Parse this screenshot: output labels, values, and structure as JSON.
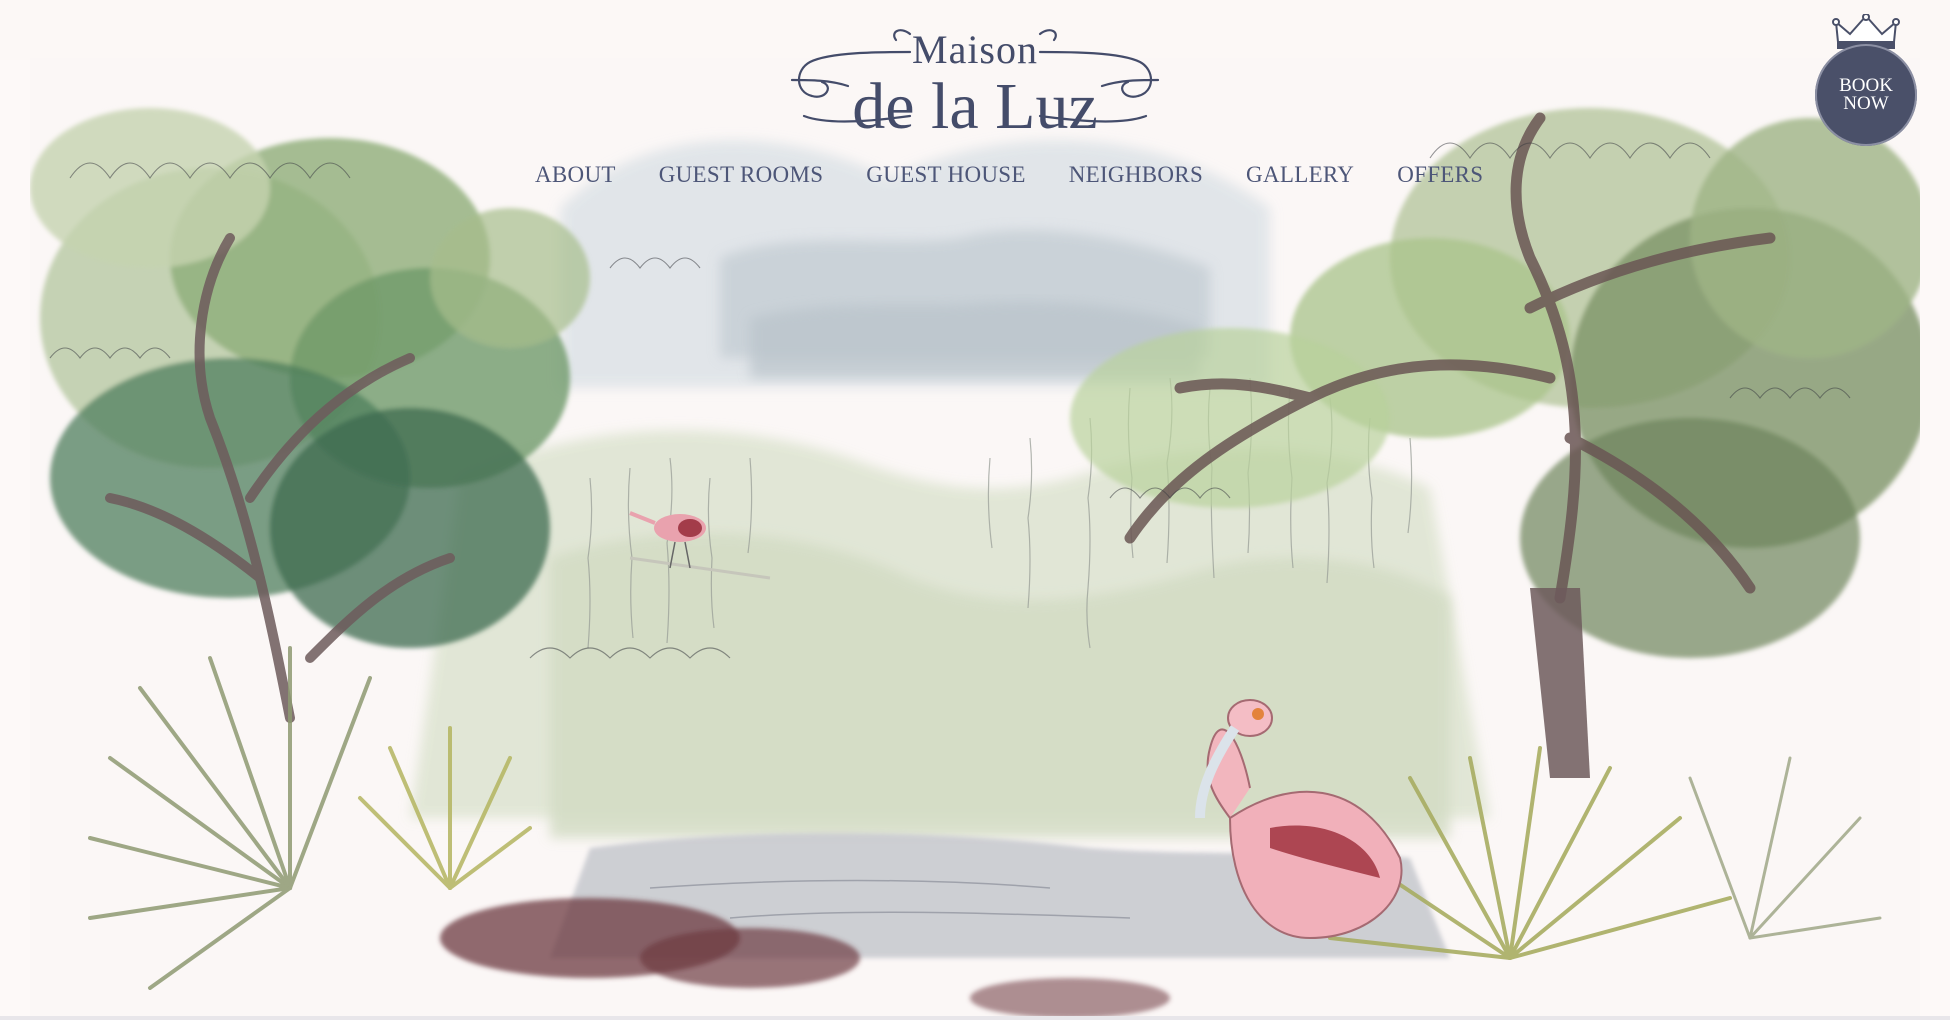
{
  "brand": {
    "line1": "Maison",
    "line2": "de la Luz"
  },
  "nav": {
    "items": [
      {
        "label": "ABOUT"
      },
      {
        "label": "GUEST ROOMS"
      },
      {
        "label": "GUEST HOUSE"
      },
      {
        "label": "NEIGHBORS"
      },
      {
        "label": "GALLERY"
      },
      {
        "label": "OFFERS"
      }
    ]
  },
  "book_now": {
    "line1": "BOOK",
    "line2": "NOW",
    "icon": "crown-icon"
  },
  "hero": {
    "icon": "watercolor-landscape-illustration"
  },
  "colors": {
    "navy": "#444c6a",
    "nav_text": "#4d5678",
    "badge": "#4a5069",
    "background": "#fdf9f8",
    "spoonbill_pink": "#e9a2ae"
  }
}
